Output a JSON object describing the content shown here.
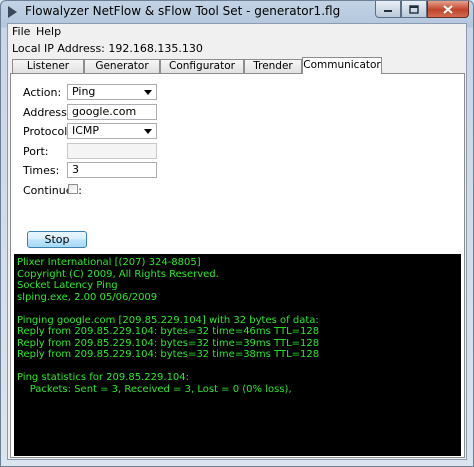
{
  "window": {
    "title": "Flowalyzer NetFlow & sFlow Tool Set - generator1.flg",
    "minimize_label": "–",
    "maximize_label": "□",
    "close_label": "✕"
  },
  "menu": {
    "file": "File",
    "help": "Help"
  },
  "local_ip": {
    "label": "Local IP Address:",
    "value": "192.168.135.130"
  },
  "tabs": [
    {
      "label": "Listener"
    },
    {
      "label": "Generator"
    },
    {
      "label": "Configurator"
    },
    {
      "label": "Trender"
    },
    {
      "label": "Communicator",
      "active": true
    }
  ],
  "form": {
    "action": {
      "label": "Action:",
      "value": "Ping"
    },
    "address": {
      "label": "Address:",
      "value": "google.com"
    },
    "protocol": {
      "label": "Protocol:",
      "value": "ICMP"
    },
    "port": {
      "label": "Port:",
      "value": ""
    },
    "times": {
      "label": "Times:",
      "value": "3"
    },
    "continues": {
      "label": "Continues:",
      "checked": false
    },
    "stop_button": "Stop"
  },
  "console": {
    "text_color": "#2ee82e",
    "background": "#000000",
    "lines": [
      "Plixer International [(207) 324-8805]",
      "Copyright (C) 2009, All Rights Reserved.",
      "Socket Latency Ping",
      "slping.exe, 2.00 05/06/2009",
      "",
      "Pinging google.com [209.85.229.104] with 32 bytes of data:",
      "Reply from 209.85.229.104: bytes=32 time=46ms TTL=128",
      "Reply from 209.85.229.104: bytes=32 time=39ms TTL=128",
      "Reply from 209.85.229.104: bytes=32 time=38ms TTL=128",
      "",
      "Ping statistics for 209.85.229.104:",
      "    Packets: Sent = 3, Received = 3, Lost = 0 (0% loss),"
    ]
  },
  "icons": {
    "app": "flowalyzer-app-icon",
    "dropdown": "chevron-down-icon"
  }
}
